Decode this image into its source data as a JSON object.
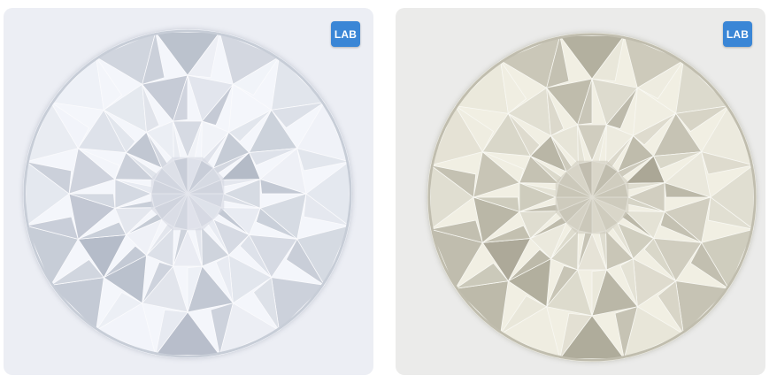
{
  "gallery": {
    "items": [
      {
        "badge": "LAB",
        "badge_color": "#3a86d6",
        "tint": "#f4f6fb",
        "shade": "#9aa3b3",
        "icon": "diamond-image"
      },
      {
        "badge": "LAB",
        "badge_color": "#3a86d6",
        "tint": "#f1efe3",
        "shade": "#8f8b78",
        "icon": "diamond-image"
      }
    ]
  }
}
